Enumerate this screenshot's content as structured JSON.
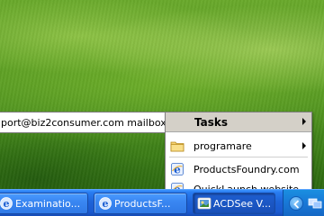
{
  "desktop": {
    "wallpaper": "green-hills"
  },
  "balloon": {
    "text": "port@biz2consumer.com mailbox,"
  },
  "menu": {
    "title": "Tasks",
    "items": [
      {
        "label": "programare",
        "icon": "folder-icon",
        "has_submenu": true
      },
      {
        "label": "ProductsFoundry.com",
        "icon": "ie-icon",
        "has_submenu": false
      },
      {
        "label": "QuickLaunch website",
        "icon": "ie-icon",
        "has_submenu": false
      }
    ]
  },
  "taskbar": {
    "buttons": [
      {
        "label": "Examinatio...",
        "icon": "ie-icon",
        "active": false
      },
      {
        "label": "ProductsF...",
        "icon": "ie-icon",
        "active": false
      },
      {
        "label": "ACDSee V...",
        "icon": "acdsee-icon",
        "active": true
      }
    ],
    "tray": {
      "icons": [
        "show-hidden-icons-chevron",
        "network-icon"
      ]
    },
    "colors": {
      "taskbar_blue": "#1d63d8",
      "tray_blue": "#1877d6"
    }
  }
}
